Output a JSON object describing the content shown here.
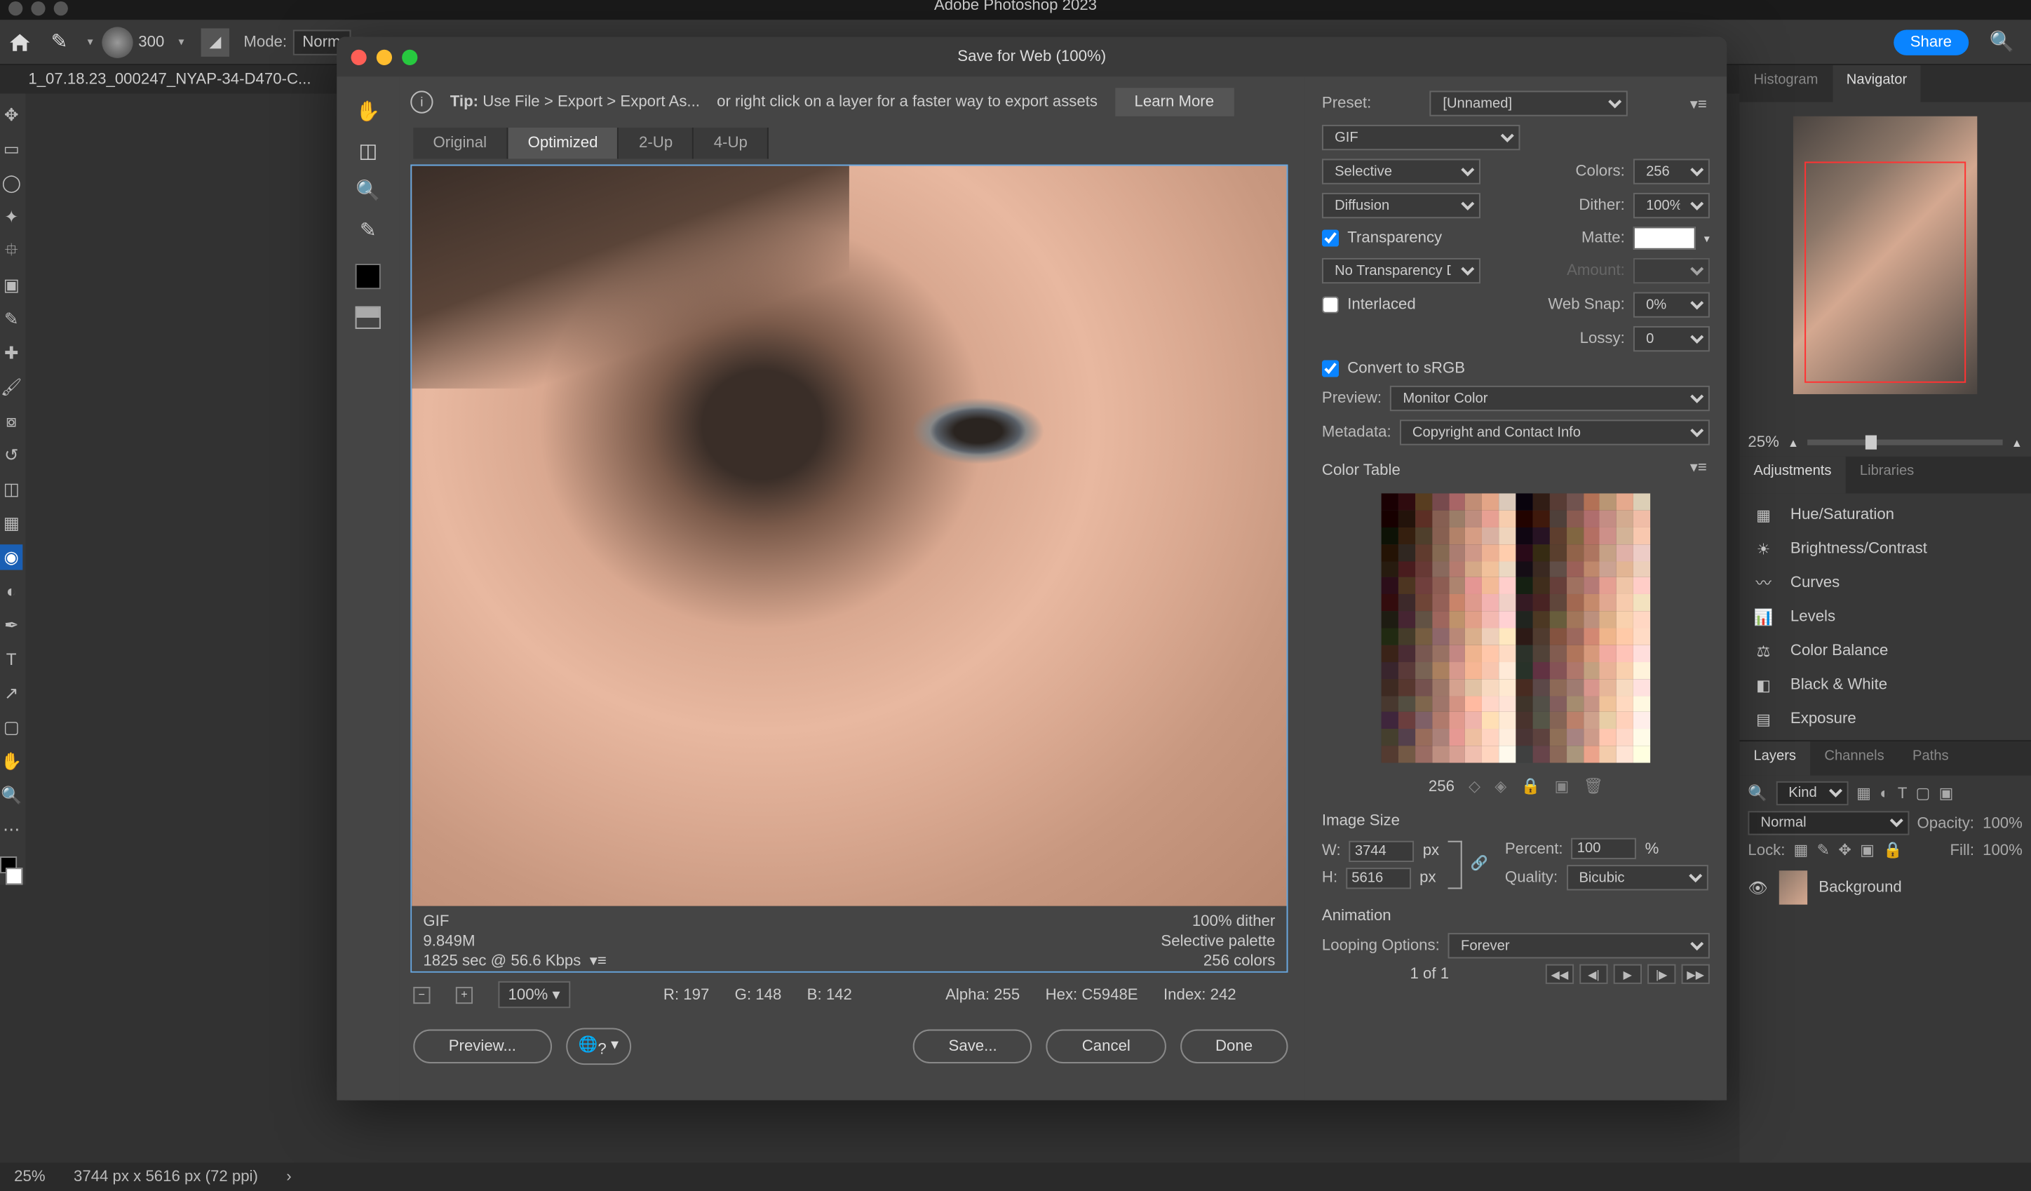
{
  "app": {
    "title": "Adobe Photoshop 2023"
  },
  "options": {
    "sizeLabel": "300",
    "modeLabel": "Mode:",
    "modeValue": "Norm",
    "share": "Share"
  },
  "doc": {
    "tab": "1_07.18.23_000247_NYAP-34-D470-C..."
  },
  "dialog": {
    "title": "Save for Web (100%)",
    "tip": {
      "prefix": "Tip:",
      "text1": "Use File > Export > Export As...",
      "text2": "or right click on a layer for a faster way to export assets",
      "learn": "Learn More"
    },
    "tabs": [
      "Original",
      "Optimized",
      "2-Up",
      "4-Up"
    ],
    "previewMeta": {
      "format": "GIF",
      "size": "9.849M",
      "time": "1825 sec @ 56.6 Kbps",
      "dither": "100% dither",
      "palette": "Selective palette",
      "colors": "256 colors"
    },
    "zoom": "100%",
    "readout": {
      "r": "R: 197",
      "g": "G: 148",
      "b": "B: 142",
      "alpha": "Alpha: 255",
      "hex": "Hex: C5948E",
      "index": "Index: 242"
    },
    "buttons": {
      "preview": "Preview...",
      "save": "Save...",
      "cancel": "Cancel",
      "done": "Done"
    },
    "settings": {
      "presetLabel": "Preset:",
      "preset": "[Unnamed]",
      "format": "GIF",
      "reduction": "Selective",
      "colorsLabel": "Colors:",
      "colors": "256",
      "ditherMethod": "Diffusion",
      "ditherLabel": "Dither:",
      "dither": "100%",
      "transparency": "Transparency",
      "matteLabel": "Matte:",
      "transDither": "No Transparency Dit...",
      "amountLabel": "Amount:",
      "interlaced": "Interlaced",
      "snapLabel": "Web Snap:",
      "snap": "0%",
      "lossyLabel": "Lossy:",
      "lossy": "0",
      "convert": "Convert to sRGB",
      "previewLabel": "Preview:",
      "previewVal": "Monitor Color",
      "metaLabel": "Metadata:",
      "metaVal": "Copyright and Contact Info",
      "colorTable": "Color Table",
      "ctCount": "256",
      "imgSizeLabel": "Image Size",
      "wLabel": "W:",
      "w": "3744",
      "hLabel": "H:",
      "h": "5616",
      "px": "px",
      "pctLabel": "Percent:",
      "pct": "100",
      "pctUnit": "%",
      "qualLabel": "Quality:",
      "qual": "Bicubic",
      "animLabel": "Animation",
      "loopLabel": "Looping Options:",
      "loop": "Forever",
      "frame": "1 of 1"
    }
  },
  "panels": {
    "navTabs": [
      "Histogram",
      "Navigator"
    ],
    "navZoom": "25%",
    "adjTabs": [
      "Adjustments",
      "Libraries"
    ],
    "adjustments": [
      "Hue/Saturation",
      "Brightness/Contrast",
      "Curves",
      "Levels",
      "Color Balance",
      "Black & White",
      "Exposure"
    ],
    "layerTabs": [
      "Layers",
      "Channels",
      "Paths"
    ],
    "kind": "Kind",
    "blend": "Normal",
    "opacityLabel": "Opacity:",
    "opacity": "100%",
    "lockLabel": "Lock:",
    "fillLabel": "Fill:",
    "fill": "100%",
    "bgLayer": "Background"
  },
  "status": {
    "zoom": "25%",
    "dims": "3744 px x 5616 px (72 ppi)"
  }
}
